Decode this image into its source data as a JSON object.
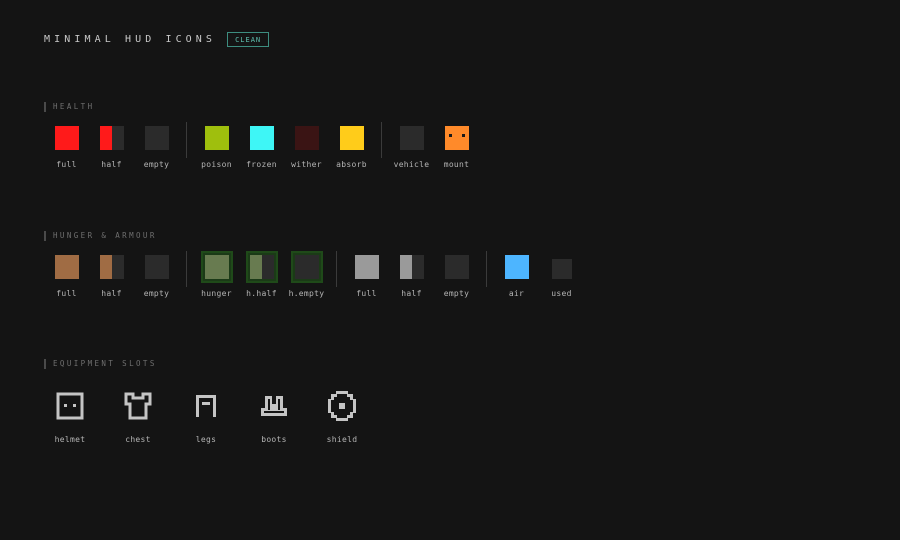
{
  "header": {
    "title": "MINIMAL HUD ICONS",
    "badge": "CLEAN"
  },
  "health": {
    "label": "HEALTH",
    "items": [
      {
        "label": "full",
        "colors": [
          "#ff1a1a"
        ]
      },
      {
        "label": "half",
        "colors": [
          "#ff1a1a",
          "#2b2b2b"
        ]
      },
      {
        "label": "empty",
        "colors": [
          "#2b2b2b"
        ]
      },
      {
        "label": "poison",
        "colors": [
          "#9fbf0d"
        ]
      },
      {
        "label": "frozen",
        "colors": [
          "#3ef6f6"
        ]
      },
      {
        "label": "wither",
        "colors": [
          "#3a1414"
        ]
      },
      {
        "label": "absorb",
        "colors": [
          "#ffcc1a"
        ]
      },
      {
        "label": "vehicle",
        "colors": [
          "#2b2b2b"
        ]
      },
      {
        "label": "mount",
        "colors": [
          "#ff8a2a"
        ]
      }
    ]
  },
  "hunger_armour": {
    "label": "HUNGER & ARMOUR",
    "items": [
      {
        "label": "full",
        "colors": [
          "#a06c44"
        ]
      },
      {
        "label": "half",
        "colors": [
          "#a06c44",
          "#2b2b2b"
        ]
      },
      {
        "label": "empty",
        "colors": [
          "#2b2b2b"
        ]
      },
      {
        "label": "hunger",
        "colors": [
          "#687b50"
        ]
      },
      {
        "label": "h.half",
        "colors": [
          "#687b50",
          "#2b2b2b"
        ]
      },
      {
        "label": "h.empty",
        "colors": [
          "#2b2b2b"
        ]
      },
      {
        "label": "full",
        "colors": [
          "#9a9a9a"
        ]
      },
      {
        "label": "half",
        "colors": [
          "#9a9a9a",
          "#2b2b2b"
        ]
      },
      {
        "label": "empty",
        "colors": [
          "#2b2b2b"
        ]
      },
      {
        "label": "air",
        "colors": [
          "#4db5ff"
        ]
      },
      {
        "label": "used",
        "colors": [
          "#2b2b2b"
        ]
      }
    ]
  },
  "equipment": {
    "label": "EQUIPMENT SLOTS",
    "items": [
      {
        "label": "helmet",
        "icon": "helmet-icon"
      },
      {
        "label": "chest",
        "icon": "chest-icon"
      },
      {
        "label": "legs",
        "icon": "legs-icon"
      },
      {
        "label": "boots",
        "icon": "boots-icon"
      },
      {
        "label": "shield",
        "icon": "shield-icon"
      }
    ]
  }
}
